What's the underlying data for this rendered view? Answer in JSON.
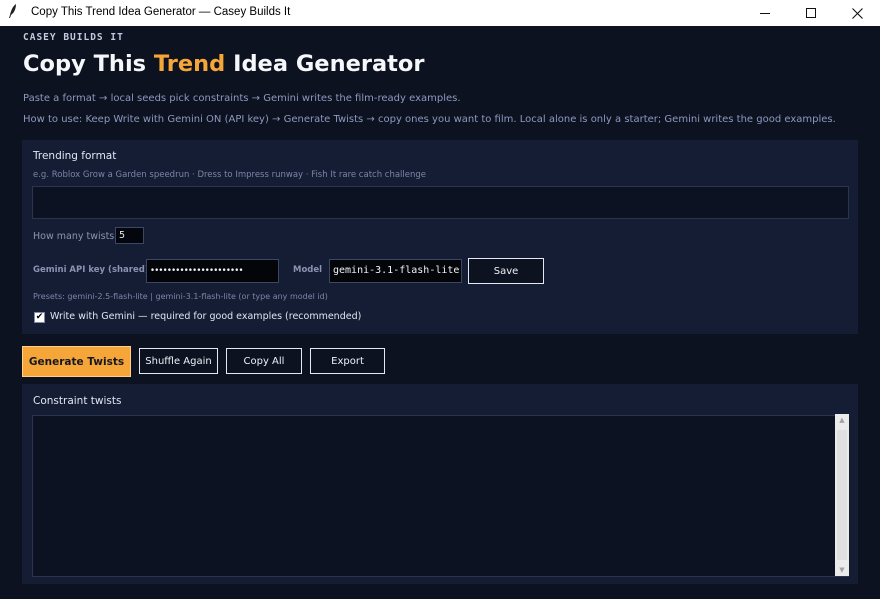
{
  "window": {
    "title": "Copy This Trend Idea Generator — Casey Builds It",
    "icon": "feather-icon"
  },
  "header": {
    "brand": "CASEY BUILDS IT",
    "title_pre": "Copy This ",
    "title_accent": "Trend",
    "title_post": " Idea Generator",
    "subtitle": "Paste a format → local seeds pick constraints → Gemini writes the film-ready examples.",
    "howto": "How to use: Keep Write with Gemini ON (API key) → Generate Twists → copy ones you want to film. Local alone is only a starter; Gemini writes the good examples."
  },
  "format": {
    "label": "Trending format",
    "hint": "e.g. Roblox Grow a Garden speedrun · Dress to Impress runway · Fish It rare catch challenge",
    "value": ""
  },
  "count": {
    "label": "How many twists",
    "value": "5"
  },
  "api": {
    "label": "Gemini API key (shared)",
    "key_masked": "••••••••••••••••••••••",
    "model_label": "Model",
    "model_value": "gemini-3.1-flash-lite",
    "save_label": "Save",
    "presets": "Presets: gemini-2.5-flash-lite  |  gemini-3.1-flash-lite  (or type any model id)"
  },
  "toggle": {
    "label": "Write with Gemini — required for good examples (recommended)",
    "checked": true,
    "check_glyph": "✔"
  },
  "actions": {
    "generate": "Generate Twists",
    "shuffle": "Shuffle Again",
    "copy_all": "Copy All",
    "export": "Export"
  },
  "output": {
    "label": "Constraint twists",
    "value": ""
  },
  "colors": {
    "background": "#0d1220",
    "panel": "#151d34",
    "accent": "#f6a638"
  }
}
